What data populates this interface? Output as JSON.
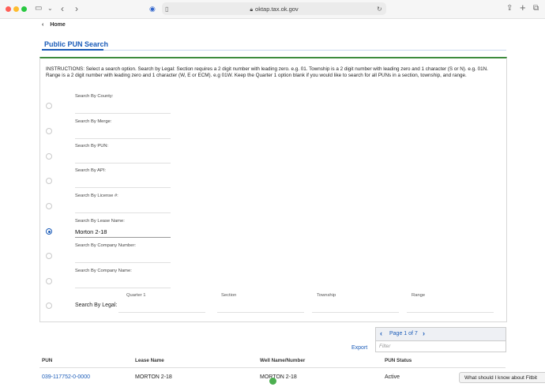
{
  "browser": {
    "url": "oktap.tax.ok.gov",
    "colors": {
      "close": "#ff5f57",
      "minimize": "#febc2e",
      "zoom": "#28c840"
    }
  },
  "breadcrumb": {
    "home": "Home"
  },
  "page_title": "Public PUN Search",
  "instructions": "INSTRUCTIONS: Select a search option. Search by Legal: Section requires a 2 digit number with leading zero. e.g. 01. Township is a 2 digit number with leading zero and 1 character (S or N). e.g. 01N. Range is a 2 digit number with leading zero and 1 character (W, E or ECM). e.g 01W. Keep the Quarter 1 option blank if you would like to search for all PUNs in a section, township, and range.",
  "search_options": [
    {
      "label": "Search By County:",
      "value": "",
      "selected": false
    },
    {
      "label": "Search By Merge:",
      "value": "",
      "selected": false
    },
    {
      "label": "Search By PUN:",
      "value": "",
      "selected": false
    },
    {
      "label": "Search By API:",
      "value": "",
      "selected": false
    },
    {
      "label": "Search By License #:",
      "value": "",
      "selected": false
    },
    {
      "label": "Search By Lease Name:",
      "value": "Morton 2-18",
      "selected": true
    },
    {
      "label": "Search By Company Number:",
      "value": "",
      "selected": false
    },
    {
      "label": "Search By Company Name:",
      "value": "",
      "selected": false
    }
  ],
  "legal": {
    "label": "Search By Legal:",
    "columns": [
      "Quarter 1",
      "Section",
      "Township",
      "Range"
    ]
  },
  "pager": {
    "text": "Page 1 of 7",
    "prev": "‹",
    "next": "›",
    "filter_placeholder": "Filter"
  },
  "export_label": "Export",
  "table": {
    "headers": [
      "PUN",
      "Lease Name",
      "Well Name/Number",
      "PUN Status"
    ],
    "rows": [
      [
        "039-117752-0-0000",
        "MORTON 2-18",
        "MORTON 2-18",
        "Active"
      ]
    ]
  },
  "tooltip": "What should I know about Fitbit"
}
